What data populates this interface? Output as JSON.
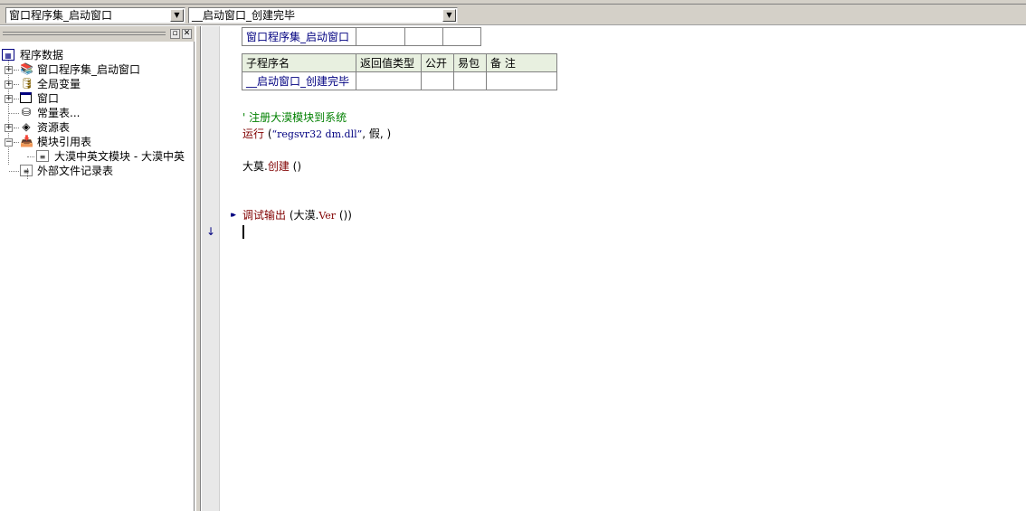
{
  "toolbar": {
    "class_combo": "窗口程序集_启动窗口",
    "sub_combo": "__启动窗口_创建完毕"
  },
  "tree": {
    "root": "程序数据",
    "items": [
      {
        "label": "窗口程序集_启动窗口",
        "icon": "assembly-icon"
      },
      {
        "label": "全局变量",
        "icon": "global-var-icon"
      },
      {
        "label": "窗口",
        "icon": "window-icon"
      },
      {
        "label": "常量表...",
        "icon": "constant-icon"
      },
      {
        "label": "资源表",
        "icon": "resource-icon"
      },
      {
        "label": "模块引用表",
        "icon": "module-ref-icon"
      },
      {
        "label": "大漠中英文模块 - 大漠中英",
        "icon": "module-file-icon"
      },
      {
        "label": "外部文件记录表",
        "icon": "external-file-icon"
      }
    ]
  },
  "editor": {
    "assembly_table": {
      "name": "窗口程序集_启动窗口"
    },
    "sub_table": {
      "headers": [
        "子程序名",
        "返回值类型",
        "公开",
        "易包",
        "备 注"
      ],
      "row": [
        "__启动窗口_创建完毕",
        "",
        "",
        "",
        ""
      ]
    },
    "lines": {
      "comment": "' 注册大漠模块到系统",
      "run_kw": "运行",
      "run_open": " (",
      "run_str": "“regsvr32 dm.dll”",
      "run_rest": ", 假, )",
      "create_obj": "大莫.",
      "create_kw": "创建",
      "create_rest": " ()",
      "debug_kw": "调试输出",
      "debug_open": " (大漠.",
      "debug_ver": "Ver",
      "debug_rest": " ())"
    }
  }
}
